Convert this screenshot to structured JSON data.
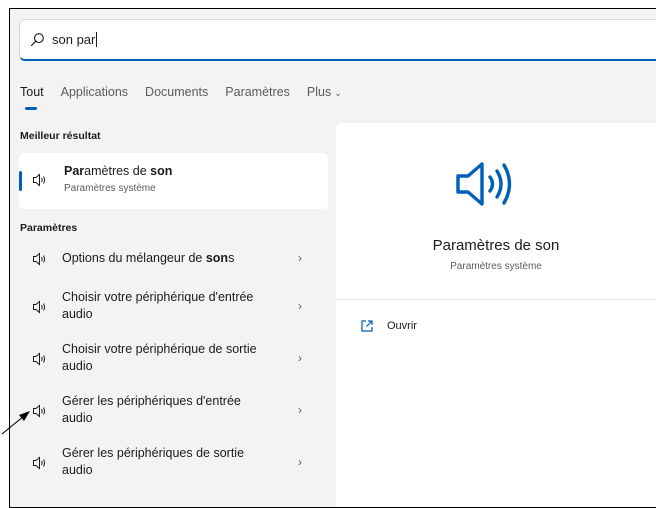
{
  "search": {
    "query": "son par"
  },
  "tabs": [
    {
      "label": "Tout",
      "active": true
    },
    {
      "label": "Applications",
      "active": false
    },
    {
      "label": "Documents",
      "active": false
    },
    {
      "label": "Paramètres",
      "active": false
    },
    {
      "label": "Plus",
      "active": false
    }
  ],
  "best_result": {
    "section_title": "Meilleur résultat",
    "title_bold_prefix": "Par",
    "title_rest": "amètres de ",
    "title_bold_suffix": "son",
    "subtitle": "Paramètres système",
    "icon": "speaker-icon"
  },
  "settings": {
    "section_title": "Paramètres",
    "items": [
      {
        "label_plain": "Options du mélangeur de ",
        "label_bold": "son",
        "label_tail": "s",
        "icon": "speaker-icon"
      },
      {
        "label_plain": "Choisir votre périphérique d'entrée audio",
        "icon": "speaker-icon"
      },
      {
        "label_plain": "Choisir votre périphérique de sortie audio",
        "icon": "speaker-icon"
      },
      {
        "label_plain": "Gérer les périphériques d'entrée audio",
        "icon": "speaker-icon"
      },
      {
        "label_plain": "Gérer les périphériques de sortie audio",
        "icon": "speaker-icon"
      }
    ]
  },
  "preview": {
    "title": "Paramètres de son",
    "subtitle": "Paramètres système",
    "action_label": "Ouvrir",
    "action_icon": "open-external-icon"
  },
  "colors": {
    "accent": "#005fb8",
    "panel_bg": "#f3f3f3",
    "card_bg": "#ffffff",
    "secondary_text": "#5c5c5c"
  }
}
